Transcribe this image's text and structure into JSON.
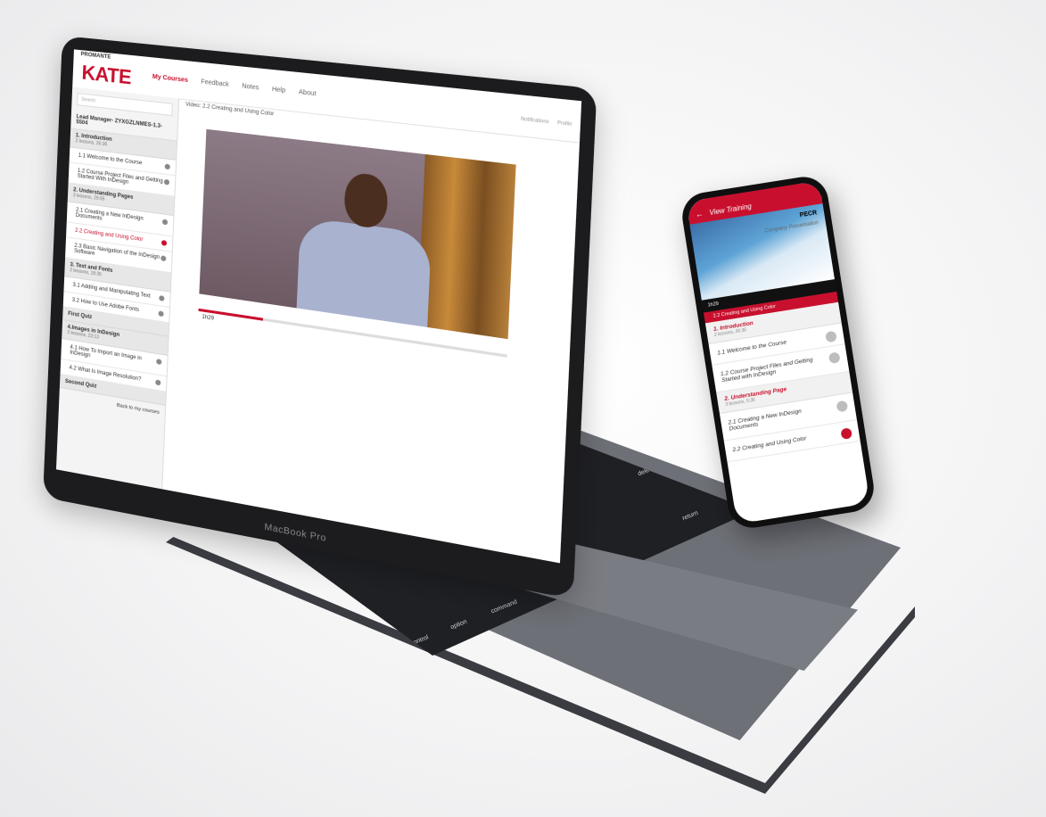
{
  "laptop": {
    "bezel_label": "MacBook Pro",
    "app": {
      "brand_small": "PROMANTE",
      "logo": "KATE",
      "nav": [
        "My Courses",
        "Feedback",
        "Notes",
        "Help",
        "About"
      ],
      "topright": [
        "Notifications",
        "Profile"
      ],
      "search_placeholder": "Search",
      "course_title": "Lead Manager- ZYXGZLNMES-1.3-5504",
      "video_title": "Video: 2.2 Creating and Using Color",
      "timer": "1h29",
      "progress_fraction": 0.22,
      "sections": [
        {
          "title": "1. Introduction",
          "meta": "2 lessons, 26:36",
          "lessons": [
            {
              "label": "1.1 Welcome to the Course",
              "active": false
            },
            {
              "label": "1.2 Course Project Files and Getting Started With InDesign",
              "active": false
            }
          ]
        },
        {
          "title": "2. Understanding Pages",
          "meta": "3 lessons, 29:55",
          "lessons": [
            {
              "label": "2.1 Creating a New InDesign Documents",
              "active": false
            },
            {
              "label": "2.2 Creating and Using Color",
              "active": true
            },
            {
              "label": "2.3 Basic Navigation of the InDesign Software",
              "active": false
            }
          ]
        },
        {
          "title": "3. Text and Fonts",
          "meta": "2 lessons, 18:35",
          "lessons": [
            {
              "label": "3.1 Adding and Manipulating Text",
              "active": false
            },
            {
              "label": "3.2 How to Use Adobe Fonts",
              "active": false
            }
          ]
        },
        {
          "title": "First Quiz",
          "meta": "",
          "lessons": []
        },
        {
          "title": "4.Images in InDesign",
          "meta": "2 lessons, 23:13",
          "lessons": [
            {
              "label": "4.1 How To Import an Image in InDesign",
              "active": false
            },
            {
              "label": "4.2 What Is Image Resolution?",
              "active": false
            }
          ]
        },
        {
          "title": "Second Quiz",
          "meta": "",
          "lessons": []
        }
      ],
      "back_link": "Back to my courses"
    },
    "keys": [
      "esc",
      "tab",
      "caps lock",
      "shift",
      "fn",
      "control",
      "option",
      "command",
      "delete",
      "return"
    ]
  },
  "phone": {
    "header_title": "View Training",
    "video_brand": "PECR",
    "video_caption": "Company Presentation",
    "time": "1h29",
    "now_playing": "2.2 Creating and Using Color",
    "sections": [
      {
        "title": "1. Introduction",
        "meta": "2 lessons, 26:36",
        "items": [
          {
            "label": "1.1 Welcome to the Course",
            "active": false
          },
          {
            "label": "1.2 Course Project Files and Getting Started with InDesign",
            "active": false
          }
        ]
      },
      {
        "title": "2. Understanding Page",
        "meta": "3 lessons, 5:36",
        "items": [
          {
            "label": "2.1 Creating a New InDesign Documents",
            "active": false
          },
          {
            "label": "2.2 Creating and Using Color",
            "active": true
          }
        ]
      }
    ]
  },
  "colors": {
    "accent": "#c8102e",
    "laptop_body": "#6e7077",
    "bezel": "#1c1c1e"
  }
}
